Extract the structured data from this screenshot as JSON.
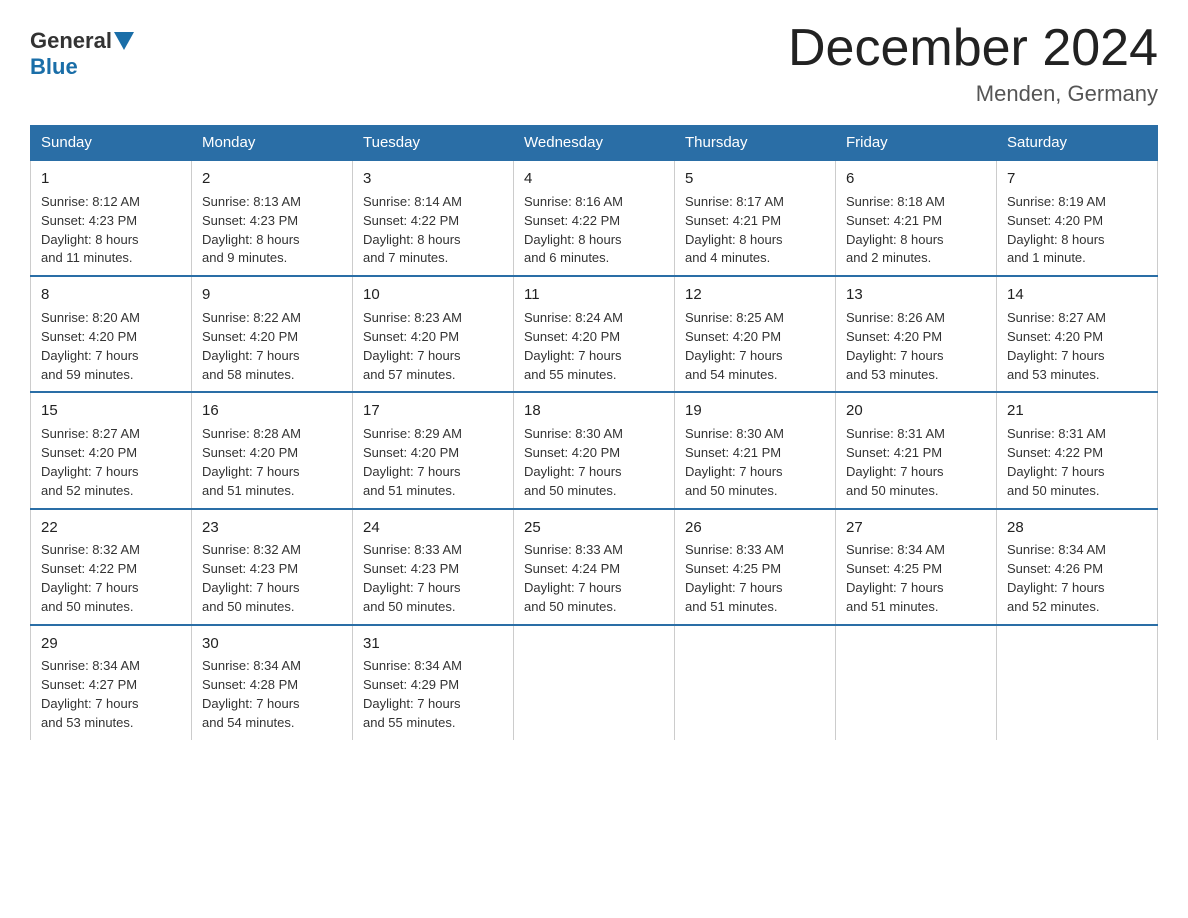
{
  "header": {
    "logo_general": "General",
    "logo_blue": "Blue",
    "month_title": "December 2024",
    "location": "Menden, Germany"
  },
  "weekdays": [
    "Sunday",
    "Monday",
    "Tuesday",
    "Wednesday",
    "Thursday",
    "Friday",
    "Saturday"
  ],
  "weeks": [
    [
      {
        "num": "1",
        "info": "Sunrise: 8:12 AM\nSunset: 4:23 PM\nDaylight: 8 hours\nand 11 minutes."
      },
      {
        "num": "2",
        "info": "Sunrise: 8:13 AM\nSunset: 4:23 PM\nDaylight: 8 hours\nand 9 minutes."
      },
      {
        "num": "3",
        "info": "Sunrise: 8:14 AM\nSunset: 4:22 PM\nDaylight: 8 hours\nand 7 minutes."
      },
      {
        "num": "4",
        "info": "Sunrise: 8:16 AM\nSunset: 4:22 PM\nDaylight: 8 hours\nand 6 minutes."
      },
      {
        "num": "5",
        "info": "Sunrise: 8:17 AM\nSunset: 4:21 PM\nDaylight: 8 hours\nand 4 minutes."
      },
      {
        "num": "6",
        "info": "Sunrise: 8:18 AM\nSunset: 4:21 PM\nDaylight: 8 hours\nand 2 minutes."
      },
      {
        "num": "7",
        "info": "Sunrise: 8:19 AM\nSunset: 4:20 PM\nDaylight: 8 hours\nand 1 minute."
      }
    ],
    [
      {
        "num": "8",
        "info": "Sunrise: 8:20 AM\nSunset: 4:20 PM\nDaylight: 7 hours\nand 59 minutes."
      },
      {
        "num": "9",
        "info": "Sunrise: 8:22 AM\nSunset: 4:20 PM\nDaylight: 7 hours\nand 58 minutes."
      },
      {
        "num": "10",
        "info": "Sunrise: 8:23 AM\nSunset: 4:20 PM\nDaylight: 7 hours\nand 57 minutes."
      },
      {
        "num": "11",
        "info": "Sunrise: 8:24 AM\nSunset: 4:20 PM\nDaylight: 7 hours\nand 55 minutes."
      },
      {
        "num": "12",
        "info": "Sunrise: 8:25 AM\nSunset: 4:20 PM\nDaylight: 7 hours\nand 54 minutes."
      },
      {
        "num": "13",
        "info": "Sunrise: 8:26 AM\nSunset: 4:20 PM\nDaylight: 7 hours\nand 53 minutes."
      },
      {
        "num": "14",
        "info": "Sunrise: 8:27 AM\nSunset: 4:20 PM\nDaylight: 7 hours\nand 53 minutes."
      }
    ],
    [
      {
        "num": "15",
        "info": "Sunrise: 8:27 AM\nSunset: 4:20 PM\nDaylight: 7 hours\nand 52 minutes."
      },
      {
        "num": "16",
        "info": "Sunrise: 8:28 AM\nSunset: 4:20 PM\nDaylight: 7 hours\nand 51 minutes."
      },
      {
        "num": "17",
        "info": "Sunrise: 8:29 AM\nSunset: 4:20 PM\nDaylight: 7 hours\nand 51 minutes."
      },
      {
        "num": "18",
        "info": "Sunrise: 8:30 AM\nSunset: 4:20 PM\nDaylight: 7 hours\nand 50 minutes."
      },
      {
        "num": "19",
        "info": "Sunrise: 8:30 AM\nSunset: 4:21 PM\nDaylight: 7 hours\nand 50 minutes."
      },
      {
        "num": "20",
        "info": "Sunrise: 8:31 AM\nSunset: 4:21 PM\nDaylight: 7 hours\nand 50 minutes."
      },
      {
        "num": "21",
        "info": "Sunrise: 8:31 AM\nSunset: 4:22 PM\nDaylight: 7 hours\nand 50 minutes."
      }
    ],
    [
      {
        "num": "22",
        "info": "Sunrise: 8:32 AM\nSunset: 4:22 PM\nDaylight: 7 hours\nand 50 minutes."
      },
      {
        "num": "23",
        "info": "Sunrise: 8:32 AM\nSunset: 4:23 PM\nDaylight: 7 hours\nand 50 minutes."
      },
      {
        "num": "24",
        "info": "Sunrise: 8:33 AM\nSunset: 4:23 PM\nDaylight: 7 hours\nand 50 minutes."
      },
      {
        "num": "25",
        "info": "Sunrise: 8:33 AM\nSunset: 4:24 PM\nDaylight: 7 hours\nand 50 minutes."
      },
      {
        "num": "26",
        "info": "Sunrise: 8:33 AM\nSunset: 4:25 PM\nDaylight: 7 hours\nand 51 minutes."
      },
      {
        "num": "27",
        "info": "Sunrise: 8:34 AM\nSunset: 4:25 PM\nDaylight: 7 hours\nand 51 minutes."
      },
      {
        "num": "28",
        "info": "Sunrise: 8:34 AM\nSunset: 4:26 PM\nDaylight: 7 hours\nand 52 minutes."
      }
    ],
    [
      {
        "num": "29",
        "info": "Sunrise: 8:34 AM\nSunset: 4:27 PM\nDaylight: 7 hours\nand 53 minutes."
      },
      {
        "num": "30",
        "info": "Sunrise: 8:34 AM\nSunset: 4:28 PM\nDaylight: 7 hours\nand 54 minutes."
      },
      {
        "num": "31",
        "info": "Sunrise: 8:34 AM\nSunset: 4:29 PM\nDaylight: 7 hours\nand 55 minutes."
      },
      {
        "num": "",
        "info": ""
      },
      {
        "num": "",
        "info": ""
      },
      {
        "num": "",
        "info": ""
      },
      {
        "num": "",
        "info": ""
      }
    ]
  ]
}
